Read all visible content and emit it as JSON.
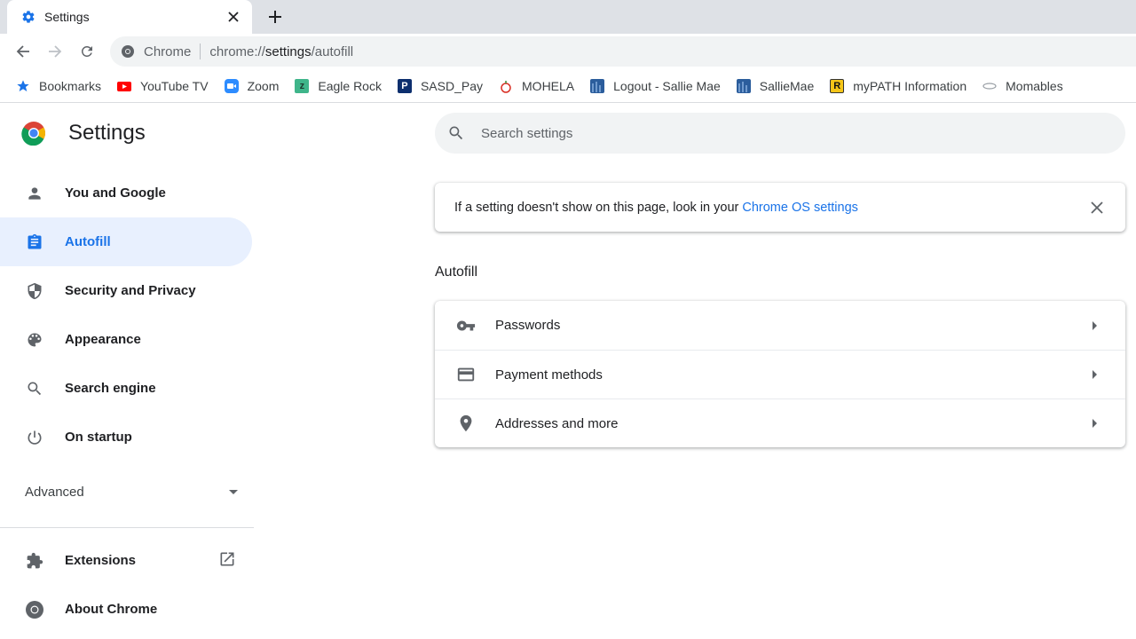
{
  "tab": {
    "title": "Settings"
  },
  "omnibox": {
    "scheme_label": "Chrome",
    "url_prefix": "chrome://",
    "url_host": "settings",
    "url_path": "/autofill"
  },
  "bookmarks": [
    {
      "label": "Bookmarks",
      "icon": "star-icon"
    },
    {
      "label": "YouTube TV",
      "icon": "youtube-icon"
    },
    {
      "label": "Zoom",
      "icon": "zoom-icon"
    },
    {
      "label": "Eagle Rock",
      "icon": "eagle-rock-icon"
    },
    {
      "label": "SASD_Pay",
      "icon": "paypal-icon"
    },
    {
      "label": "MOHELA",
      "icon": "apple-icon"
    },
    {
      "label": "Logout - Sallie Mae",
      "icon": "sallie-mae-icon"
    },
    {
      "label": "SallieMae",
      "icon": "sallie-mae-icon"
    },
    {
      "label": "myPATH Information",
      "icon": "mypath-icon"
    },
    {
      "label": "Momables",
      "icon": "momables-icon"
    }
  ],
  "sidebar": {
    "title": "Settings",
    "items": [
      {
        "label": "You and Google",
        "icon": "person-icon"
      },
      {
        "label": "Autofill",
        "icon": "clipboard-icon",
        "active": true
      },
      {
        "label": "Security and Privacy",
        "icon": "shield-icon"
      },
      {
        "label": "Appearance",
        "icon": "palette-icon"
      },
      {
        "label": "Search engine",
        "icon": "search-icon"
      },
      {
        "label": "On startup",
        "icon": "power-icon"
      }
    ],
    "advanced_label": "Advanced",
    "extensions_label": "Extensions",
    "about_label": "About Chrome"
  },
  "search": {
    "placeholder": "Search settings"
  },
  "notice": {
    "text": "If a setting doesn't show on this page, look in your",
    "link": "Chrome OS settings"
  },
  "autofill": {
    "title": "Autofill",
    "rows": [
      {
        "label": "Passwords",
        "icon": "key-icon"
      },
      {
        "label": "Payment methods",
        "icon": "credit-card-icon"
      },
      {
        "label": "Addresses and more",
        "icon": "location-pin-icon"
      }
    ]
  },
  "colors": {
    "accent": "#1a73e8",
    "active_bg": "#e8f0fe",
    "tabstrip": "#dee1e6"
  }
}
